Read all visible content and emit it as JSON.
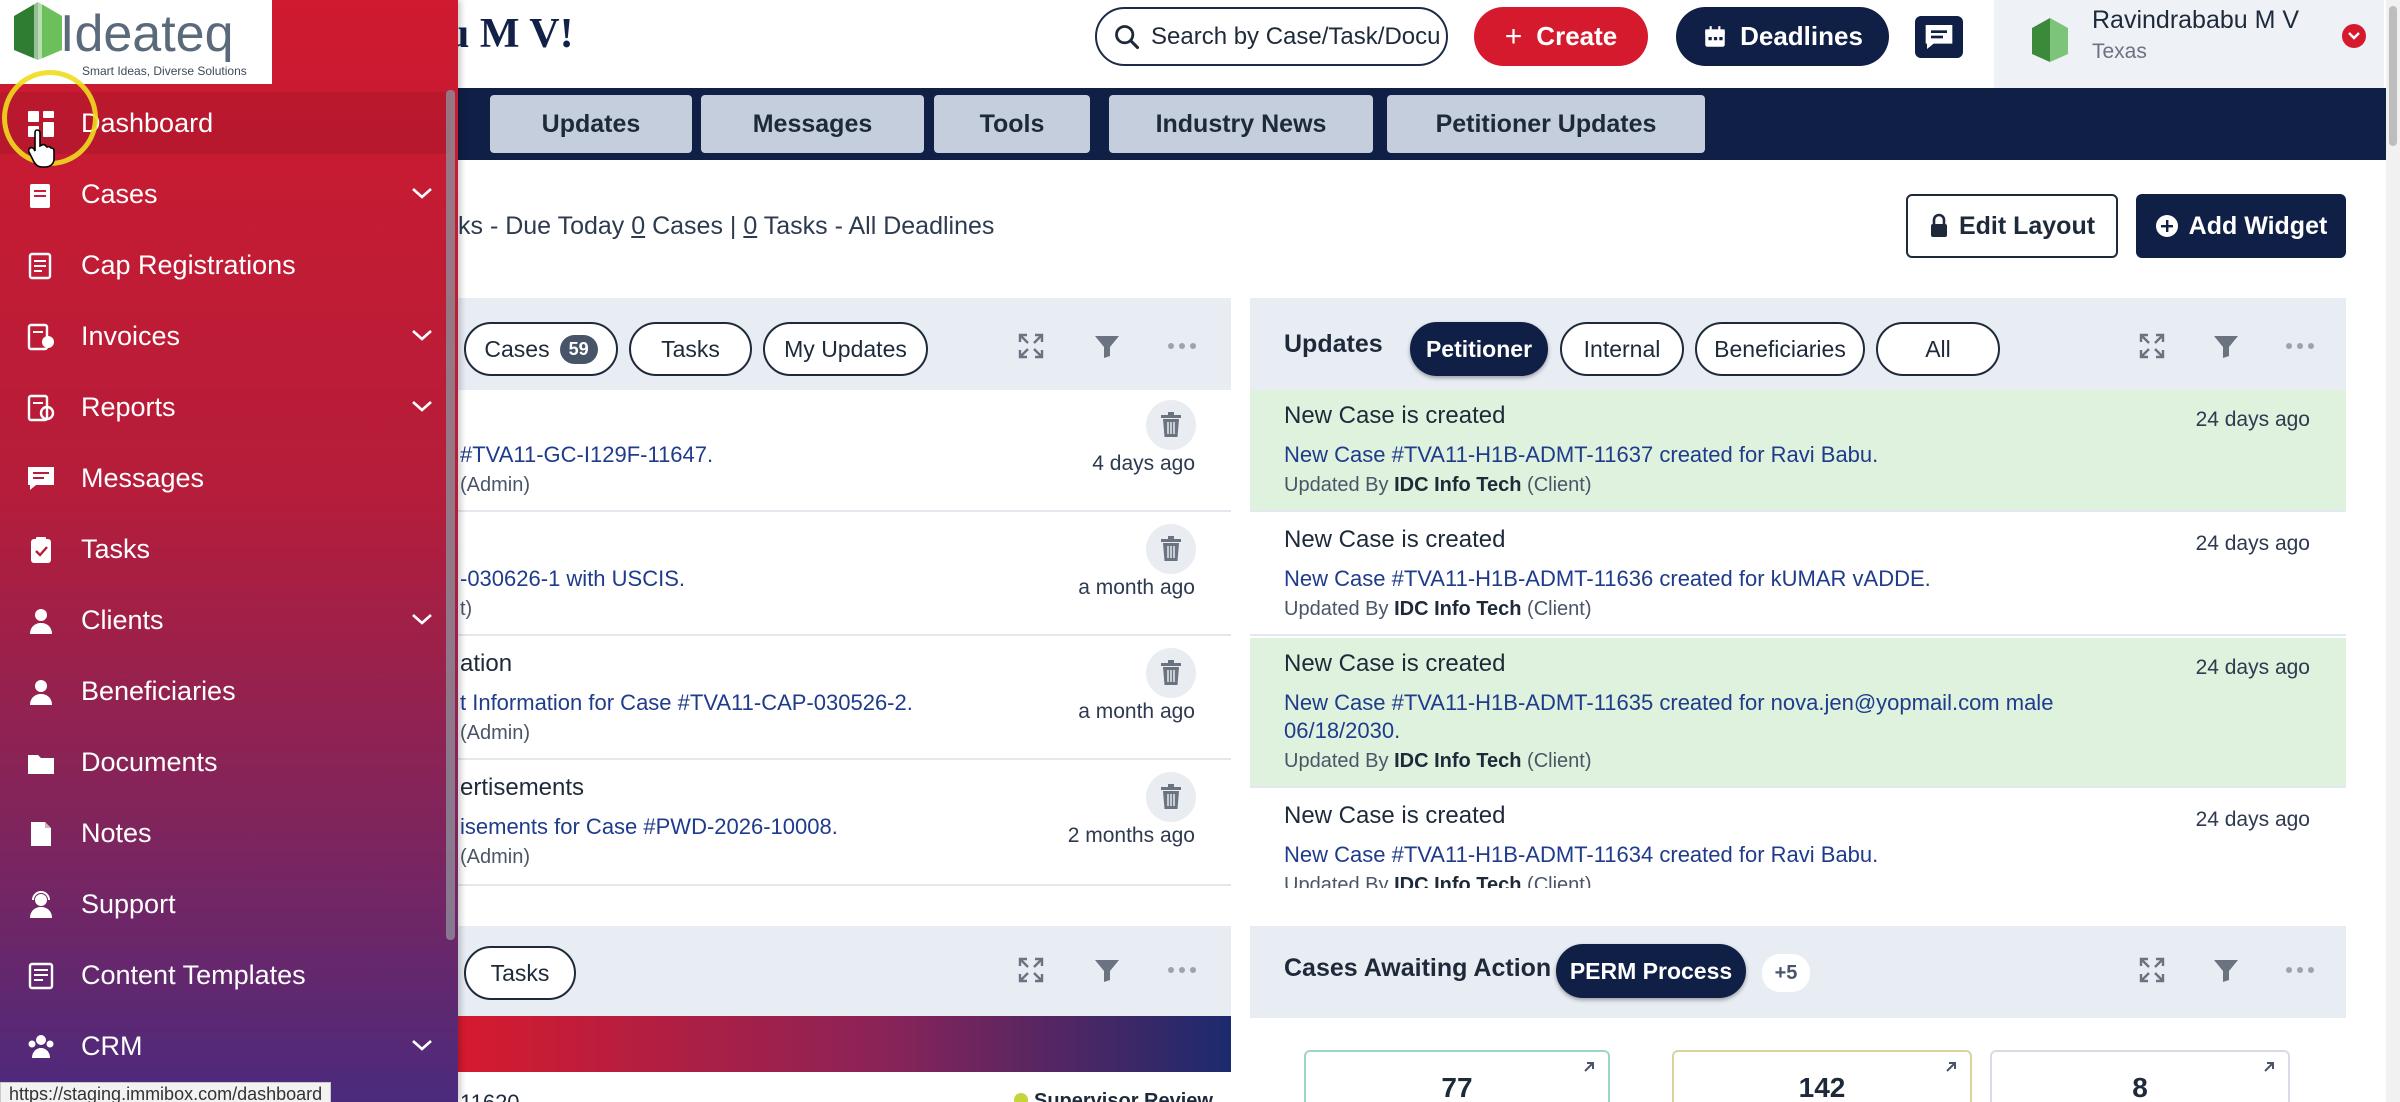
{
  "header": {
    "welcome_text": "u M V!",
    "search_placeholder": "Search by Case/Task/Docu",
    "create_label": "Create",
    "deadlines_label": "Deadlines",
    "user_name": "Ravindrababu M V",
    "user_location": "Texas"
  },
  "tabs": [
    "Updates",
    "Messages",
    "Tools",
    "Industry News",
    "Petitioner Updates"
  ],
  "summary": {
    "prefix": "ks - Due Today ",
    "cases_count": "0",
    "cases_word": " Cases | ",
    "tasks_count": "0",
    "tasks_suffix": " Tasks - All Deadlines"
  },
  "actions": {
    "edit_layout": "Edit Layout",
    "add_widget": "Add Widget"
  },
  "left_widget": {
    "filters": [
      {
        "label": "Cases",
        "count": "59"
      },
      {
        "label": "Tasks"
      },
      {
        "label": "My Updates"
      }
    ],
    "items": [
      {
        "title": "",
        "desc": "#TVA11-GC-I129F-11647.",
        "by": "(Admin)",
        "time": "4 days ago"
      },
      {
        "title": "",
        "desc": "-030626-1 with USCIS.",
        "by": "t)",
        "time": "a month ago"
      },
      {
        "title": "ation",
        "desc": "t Information for Case #TVA11-CAP-030526-2.",
        "by": "(Admin)",
        "time": "a month ago"
      },
      {
        "title": "ertisements",
        "desc": "isements for Case #PWD-2026-10008.",
        "by": "(Admin)",
        "time": "2 months ago"
      }
    ]
  },
  "updates_widget": {
    "title": "Updates",
    "filters": [
      "Petitioner",
      "Internal",
      "Beneficiaries",
      "All"
    ],
    "active_filter": "Petitioner",
    "items": [
      {
        "title": "New Case is created",
        "desc": "New Case #TVA11-H1B-ADMT-11637 created for Ravi Babu.",
        "desc2": "",
        "by_prefix": "Updated By ",
        "by_name": "IDC Info Tech",
        "by_suffix": " (Client)",
        "time": "24 days ago",
        "highlight": true
      },
      {
        "title": "New Case is created",
        "desc": "New Case #TVA11-H1B-ADMT-11636 created for kUMAR vADDE.",
        "desc2": "",
        "by_prefix": "Updated By ",
        "by_name": "IDC Info Tech",
        "by_suffix": " (Client)",
        "time": "24 days ago",
        "highlight": false
      },
      {
        "title": "New Case is created",
        "desc": "New Case #TVA11-H1B-ADMT-11635 created for nova.jen@yopmail.com male",
        "desc2": "06/18/2030.",
        "by_prefix": "Updated By ",
        "by_name": "IDC Info Tech",
        "by_suffix": " (Client)",
        "time": "24 days ago",
        "highlight": true
      },
      {
        "title": "New Case is created",
        "desc": "New Case #TVA11-H1B-ADMT-11634 created for Ravi Babu.",
        "desc2": "",
        "by_prefix": "Updated By ",
        "by_name": "IDC Info Tech",
        "by_suffix": " (Client)",
        "time": "24 days ago",
        "highlight": false
      }
    ]
  },
  "tasks_widget": {
    "filter_label": "Tasks",
    "row_partial": "11620",
    "status_partial": "Supervisor Review"
  },
  "cases_awaiting": {
    "title": "Cases Awaiting Action",
    "active_filter": "PERM Process",
    "more": "+5",
    "stats": [
      "77",
      "142",
      "8"
    ]
  },
  "sidebar": {
    "brand": "Ideateq",
    "tagline": "Smart Ideas, Diverse Solutions",
    "items": [
      {
        "label": "Dashboard",
        "icon": "dashboard-icon",
        "expandable": false
      },
      {
        "label": "Cases",
        "icon": "cases-icon",
        "expandable": true
      },
      {
        "label": "Cap Registrations",
        "icon": "cap-registrations-icon",
        "expandable": false
      },
      {
        "label": "Invoices",
        "icon": "invoices-icon",
        "expandable": true
      },
      {
        "label": "Reports",
        "icon": "reports-icon",
        "expandable": true
      },
      {
        "label": "Messages",
        "icon": "messages-icon",
        "expandable": false
      },
      {
        "label": "Tasks",
        "icon": "tasks-icon",
        "expandable": false
      },
      {
        "label": "Clients",
        "icon": "clients-icon",
        "expandable": true
      },
      {
        "label": "Beneficiaries",
        "icon": "beneficiaries-icon",
        "expandable": false
      },
      {
        "label": "Documents",
        "icon": "documents-icon",
        "expandable": false
      },
      {
        "label": "Notes",
        "icon": "notes-icon",
        "expandable": false
      },
      {
        "label": "Support",
        "icon": "support-icon",
        "expandable": false
      },
      {
        "label": "Content Templates",
        "icon": "content-templates-icon",
        "expandable": false
      },
      {
        "label": "CRM",
        "icon": "crm-icon",
        "expandable": true
      }
    ]
  },
  "status_bar_url": "https://staging.immibox.com/dashboard",
  "colors": {
    "brand_red": "#d61a2e",
    "navy": "#0f1f46",
    "highlight_green": "#dff2dd",
    "link_blue": "#1f3b8c"
  }
}
